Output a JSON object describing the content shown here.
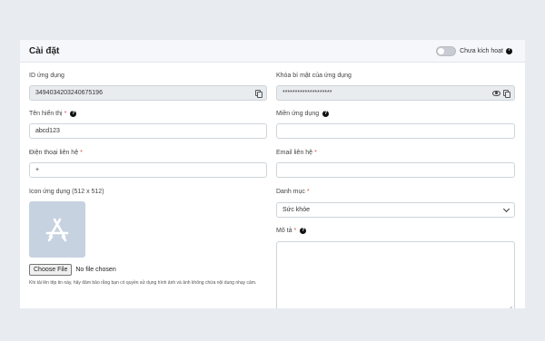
{
  "header": {
    "title": "Cài đặt",
    "toggle_label": "Chưa kích hoạt",
    "toggle_on": false
  },
  "form": {
    "app_id": {
      "label": "ID ứng dụng",
      "value": "3494034203240675196"
    },
    "secret": {
      "label": "Khóa bí mật của ứng dụng",
      "value": "********************"
    },
    "display_name": {
      "label": "Tên hiển thị",
      "value": "abcd123"
    },
    "domain": {
      "label": "Miền ứng dụng",
      "value": ""
    },
    "phone": {
      "label": "Điện thoại liên hệ",
      "value": "+"
    },
    "email": {
      "label": "Email liên hệ",
      "value": ""
    },
    "icon": {
      "label": "Icon ứng dụng (512 x 512)",
      "file_button": "Choose File",
      "file_status": "No file chosen",
      "note": "Khi tải lên tệp tin này, hãy đảm bảo rằng bạn có quyền sử dụng hình ảnh và ảnh không chứa nội dung nhạy cảm."
    },
    "category": {
      "label": "Danh mục",
      "selected": "Sức khỏe"
    },
    "description": {
      "label": "Mô tả",
      "value": ""
    },
    "required_mark": "*",
    "help_glyph": "?"
  },
  "colors": {
    "page_bg": "#e8ecf1",
    "icon_placeholder": "#c7d2e1",
    "required": "#d9534f"
  }
}
